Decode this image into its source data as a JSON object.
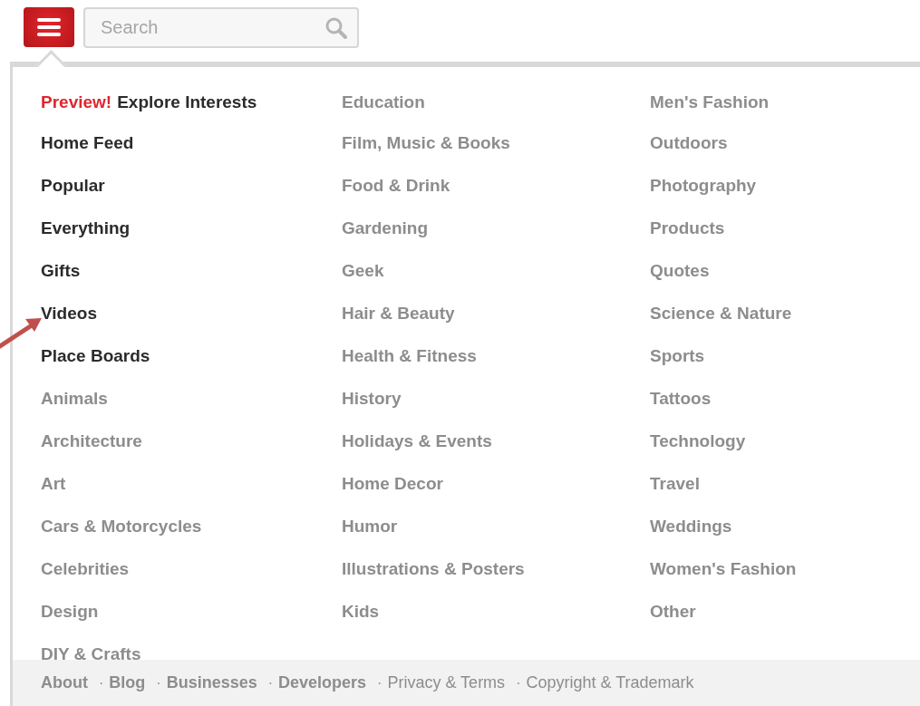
{
  "header": {
    "search": {
      "placeholder": "Search"
    }
  },
  "menu": {
    "columns": [
      {
        "items": [
          {
            "kind": "preview",
            "badge": "Preview!",
            "label": "Explore Interests"
          },
          {
            "kind": "main",
            "label": "Home Feed"
          },
          {
            "kind": "main",
            "label": "Popular"
          },
          {
            "kind": "main",
            "label": "Everything"
          },
          {
            "kind": "main",
            "label": "Gifts"
          },
          {
            "kind": "main",
            "label": "Videos"
          },
          {
            "kind": "main",
            "label": "Place Boards"
          },
          {
            "kind": "category",
            "label": "Animals"
          },
          {
            "kind": "category",
            "label": "Architecture"
          },
          {
            "kind": "category",
            "label": "Art"
          },
          {
            "kind": "category",
            "label": "Cars & Motorcycles"
          },
          {
            "kind": "category",
            "label": "Celebrities"
          },
          {
            "kind": "category",
            "label": "Design"
          },
          {
            "kind": "category",
            "label": "DIY & Crafts"
          }
        ]
      },
      {
        "items": [
          {
            "kind": "category",
            "label": "Education"
          },
          {
            "kind": "category",
            "label": "Film, Music & Books"
          },
          {
            "kind": "category",
            "label": "Food & Drink"
          },
          {
            "kind": "category",
            "label": "Gardening"
          },
          {
            "kind": "category",
            "label": "Geek"
          },
          {
            "kind": "category",
            "label": "Hair & Beauty"
          },
          {
            "kind": "category",
            "label": "Health & Fitness"
          },
          {
            "kind": "category",
            "label": "History"
          },
          {
            "kind": "category",
            "label": "Holidays & Events"
          },
          {
            "kind": "category",
            "label": "Home Decor"
          },
          {
            "kind": "category",
            "label": "Humor"
          },
          {
            "kind": "category",
            "label": "Illustrations & Posters"
          },
          {
            "kind": "category",
            "label": "Kids"
          }
        ]
      },
      {
        "items": [
          {
            "kind": "category",
            "label": "Men's Fashion"
          },
          {
            "kind": "category",
            "label": "Outdoors"
          },
          {
            "kind": "category",
            "label": "Photography"
          },
          {
            "kind": "category",
            "label": "Products"
          },
          {
            "kind": "category",
            "label": "Quotes"
          },
          {
            "kind": "category",
            "label": "Science & Nature"
          },
          {
            "kind": "category",
            "label": "Sports"
          },
          {
            "kind": "category",
            "label": "Tattoos"
          },
          {
            "kind": "category",
            "label": "Technology"
          },
          {
            "kind": "category",
            "label": "Travel"
          },
          {
            "kind": "category",
            "label": "Weddings"
          },
          {
            "kind": "category",
            "label": "Women's Fashion"
          },
          {
            "kind": "category",
            "label": "Other"
          }
        ]
      }
    ]
  },
  "footer": {
    "links": [
      {
        "kind": "primary",
        "label": "About"
      },
      {
        "kind": "primary",
        "separator": "·",
        "label": "Blog"
      },
      {
        "kind": "primary",
        "separator": "·",
        "label": "Businesses"
      },
      {
        "kind": "primary",
        "separator": "·",
        "label": "Developers"
      },
      {
        "kind": "secondary",
        "separator": "·",
        "label": "Privacy & Terms"
      },
      {
        "kind": "secondary",
        "separator": "·",
        "label": "Copyright & Trademark"
      }
    ]
  }
}
